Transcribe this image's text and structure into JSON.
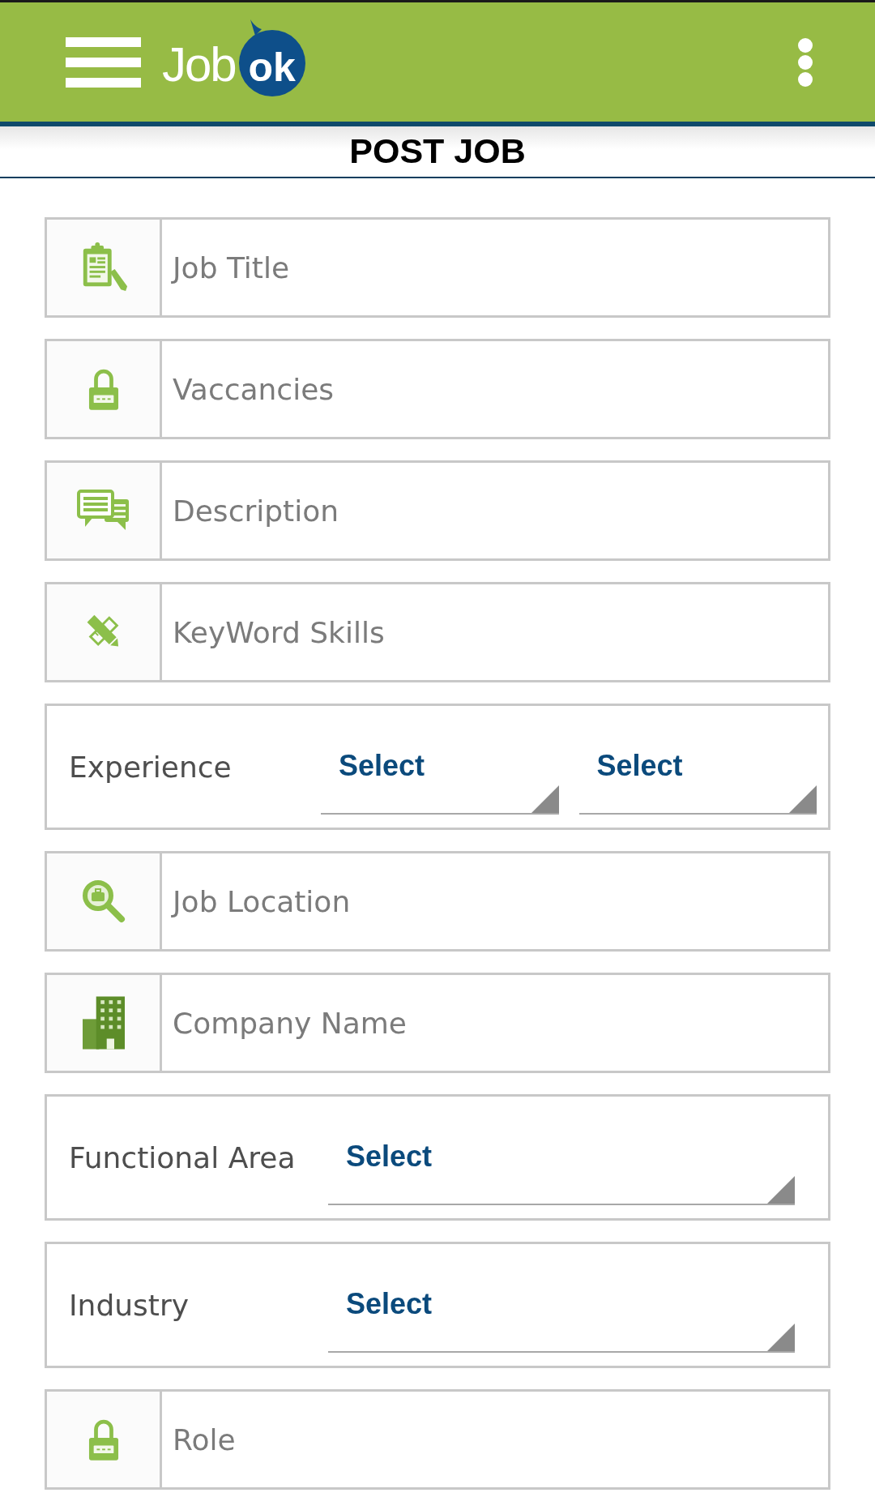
{
  "header": {
    "logo": {
      "text": "Job",
      "badge": "ok"
    }
  },
  "page_title": "POST JOB",
  "form": {
    "fields": [
      {
        "kind": "text",
        "placeholder": "Job Title"
      },
      {
        "kind": "text",
        "placeholder": "Vaccancies"
      },
      {
        "kind": "text",
        "placeholder": "Description"
      },
      {
        "kind": "text",
        "placeholder": "KeyWord Skills"
      },
      {
        "kind": "select",
        "label": "Experience",
        "selects": [
          "Select",
          "Select"
        ]
      },
      {
        "kind": "text",
        "placeholder": "Job Location"
      },
      {
        "kind": "text",
        "placeholder": "Company Name"
      },
      {
        "kind": "select",
        "label": "Functional Area",
        "selects": [
          "Select"
        ]
      },
      {
        "kind": "select",
        "label": "Industry",
        "selects": [
          "Select"
        ]
      },
      {
        "kind": "text",
        "placeholder": "Role"
      }
    ]
  }
}
